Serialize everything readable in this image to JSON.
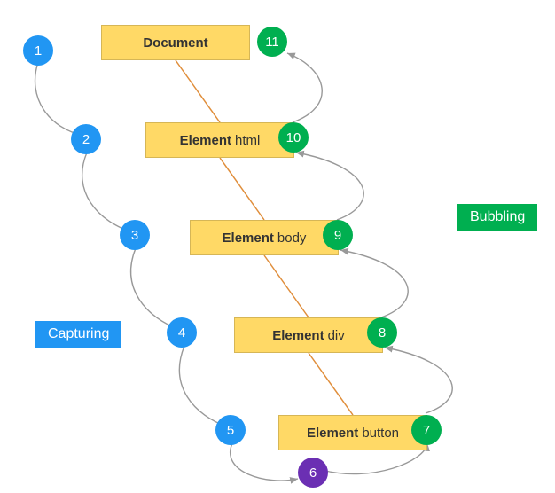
{
  "nodes": {
    "n0": {
      "bold": "Document",
      "reg": ""
    },
    "n1": {
      "bold": "Element",
      "reg": "html"
    },
    "n2": {
      "bold": "Element",
      "reg": "body"
    },
    "n3": {
      "bold": "Element",
      "reg": "div"
    },
    "n4": {
      "bold": "Element",
      "reg": "button"
    }
  },
  "steps": {
    "s1": "1",
    "s2": "2",
    "s3": "3",
    "s4": "4",
    "s5": "5",
    "s6": "6",
    "s7": "7",
    "s8": "8",
    "s9": "9",
    "s10": "10",
    "s11": "11"
  },
  "labels": {
    "capturing": "Capturing",
    "bubbling": "Bubbling"
  }
}
